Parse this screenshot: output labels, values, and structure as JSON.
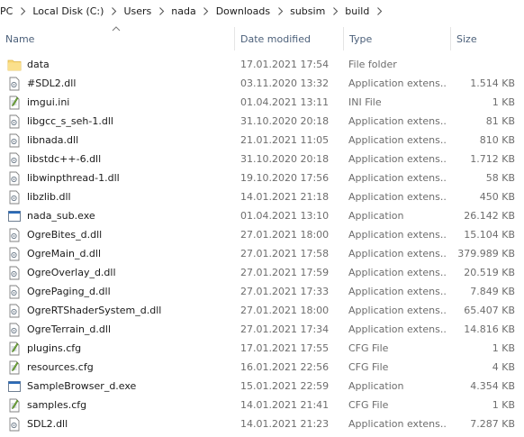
{
  "breadcrumb": [
    "PC",
    "Local Disk (C:)",
    "Users",
    "nada",
    "Downloads",
    "subsim",
    "build"
  ],
  "columns": {
    "name": "Name",
    "date": "Date modified",
    "type": "Type",
    "size": "Size"
  },
  "files": [
    {
      "name": "data",
      "date": "17.01.2021 17:54",
      "type": "File folder",
      "size": "",
      "icon": "folder-icon"
    },
    {
      "name": "#SDL2.dll",
      "date": "03.11.2020 13:32",
      "type": "Application extens...",
      "size": "1.514 KB",
      "icon": "dll-file-icon"
    },
    {
      "name": "imgui.ini",
      "date": "01.04.2021 13:11",
      "type": "INI File",
      "size": "1 KB",
      "icon": "ini-file-icon"
    },
    {
      "name": "libgcc_s_seh-1.dll",
      "date": "31.10.2020 20:18",
      "type": "Application extens...",
      "size": "81 KB",
      "icon": "dll-file-icon"
    },
    {
      "name": "libnada.dll",
      "date": "21.01.2021 11:05",
      "type": "Application extens...",
      "size": "810 KB",
      "icon": "dll-file-icon"
    },
    {
      "name": "libstdc++-6.dll",
      "date": "31.10.2020 20:18",
      "type": "Application extens...",
      "size": "1.712 KB",
      "icon": "dll-file-icon"
    },
    {
      "name": "libwinpthread-1.dll",
      "date": "19.10.2020 17:56",
      "type": "Application extens...",
      "size": "58 KB",
      "icon": "dll-file-icon"
    },
    {
      "name": "libzlib.dll",
      "date": "14.01.2021 21:18",
      "type": "Application extens...",
      "size": "450 KB",
      "icon": "dll-file-icon"
    },
    {
      "name": "nada_sub.exe",
      "date": "01.04.2021 13:10",
      "type": "Application",
      "size": "26.142 KB",
      "icon": "exe-file-icon"
    },
    {
      "name": "OgreBites_d.dll",
      "date": "27.01.2021 18:00",
      "type": "Application extens...",
      "size": "15.104 KB",
      "icon": "dll-file-icon"
    },
    {
      "name": "OgreMain_d.dll",
      "date": "27.01.2021 17:58",
      "type": "Application extens...",
      "size": "379.989 KB",
      "icon": "dll-file-icon"
    },
    {
      "name": "OgreOverlay_d.dll",
      "date": "27.01.2021 17:59",
      "type": "Application extens...",
      "size": "20.519 KB",
      "icon": "dll-file-icon"
    },
    {
      "name": "OgrePaging_d.dll",
      "date": "27.01.2021 17:33",
      "type": "Application extens...",
      "size": "7.849 KB",
      "icon": "dll-file-icon"
    },
    {
      "name": "OgreRTShaderSystem_d.dll",
      "date": "27.01.2021 18:00",
      "type": "Application extens...",
      "size": "65.407 KB",
      "icon": "dll-file-icon"
    },
    {
      "name": "OgreTerrain_d.dll",
      "date": "27.01.2021 17:34",
      "type": "Application extens...",
      "size": "14.816 KB",
      "icon": "dll-file-icon"
    },
    {
      "name": "plugins.cfg",
      "date": "17.01.2021 17:55",
      "type": "CFG File",
      "size": "1 KB",
      "icon": "cfg-file-icon"
    },
    {
      "name": "resources.cfg",
      "date": "16.01.2021 22:56",
      "type": "CFG File",
      "size": "4 KB",
      "icon": "cfg-file-icon"
    },
    {
      "name": "SampleBrowser_d.exe",
      "date": "15.01.2021 22:59",
      "type": "Application",
      "size": "4.354 KB",
      "icon": "exe-file-icon"
    },
    {
      "name": "samples.cfg",
      "date": "14.01.2021 21:41",
      "type": "CFG File",
      "size": "1 KB",
      "icon": "cfg-file-icon"
    },
    {
      "name": "SDL2.dll",
      "date": "14.01.2021 21:23",
      "type": "Application extens...",
      "size": "7.287 KB",
      "icon": "dll-file-icon"
    }
  ],
  "colors": {
    "header_text": "#4c607a",
    "secondary_text": "#6d6d6d",
    "folder": "#f8d775"
  }
}
